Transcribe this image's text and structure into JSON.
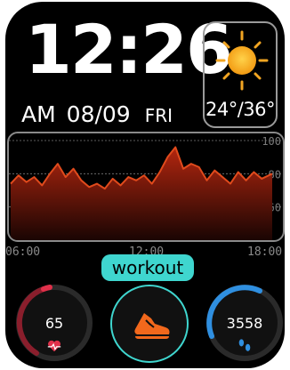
{
  "clock": {
    "time": "12:26",
    "ampm": "AM",
    "date": "08/09",
    "weekday": "FRI"
  },
  "weather": {
    "icon": "sun-icon",
    "temperature": "24°/36°"
  },
  "chart_data": {
    "type": "area",
    "x_ticks": [
      "06:00",
      "12:00",
      "18:00"
    ],
    "y_ticks": [
      "100",
      "80",
      "60"
    ],
    "ylim": [
      40,
      100
    ],
    "xlim": [
      0,
      100
    ],
    "x": [
      0,
      3,
      6,
      9,
      12,
      15,
      18,
      21,
      24,
      27,
      30,
      33,
      36,
      39,
      42,
      45,
      48,
      51,
      54,
      57,
      60,
      63,
      66,
      69,
      72,
      75,
      78,
      81,
      84,
      87,
      90,
      93,
      96,
      100
    ],
    "values": [
      74,
      79,
      75,
      78,
      73,
      80,
      86,
      78,
      83,
      76,
      72,
      74,
      71,
      77,
      73,
      78,
      76,
      79,
      74,
      81,
      90,
      96,
      83,
      86,
      84,
      76,
      82,
      78,
      74,
      81,
      76,
      81,
      77,
      80
    ],
    "colors": {
      "line": "#e04a1c",
      "fill_top": "#b3260f",
      "fill_bottom": "#1a0503",
      "grid": "#7a7a7a"
    }
  },
  "workout": {
    "label": "workout",
    "icon": "shoe-icon",
    "accent": "#3fd6cf"
  },
  "heart_rate": {
    "value": "65",
    "icon": "heart-icon",
    "accent": "#e0304a"
  },
  "steps": {
    "value": "3558",
    "icon": "footsteps-icon",
    "accent": "#2f8fe0"
  }
}
